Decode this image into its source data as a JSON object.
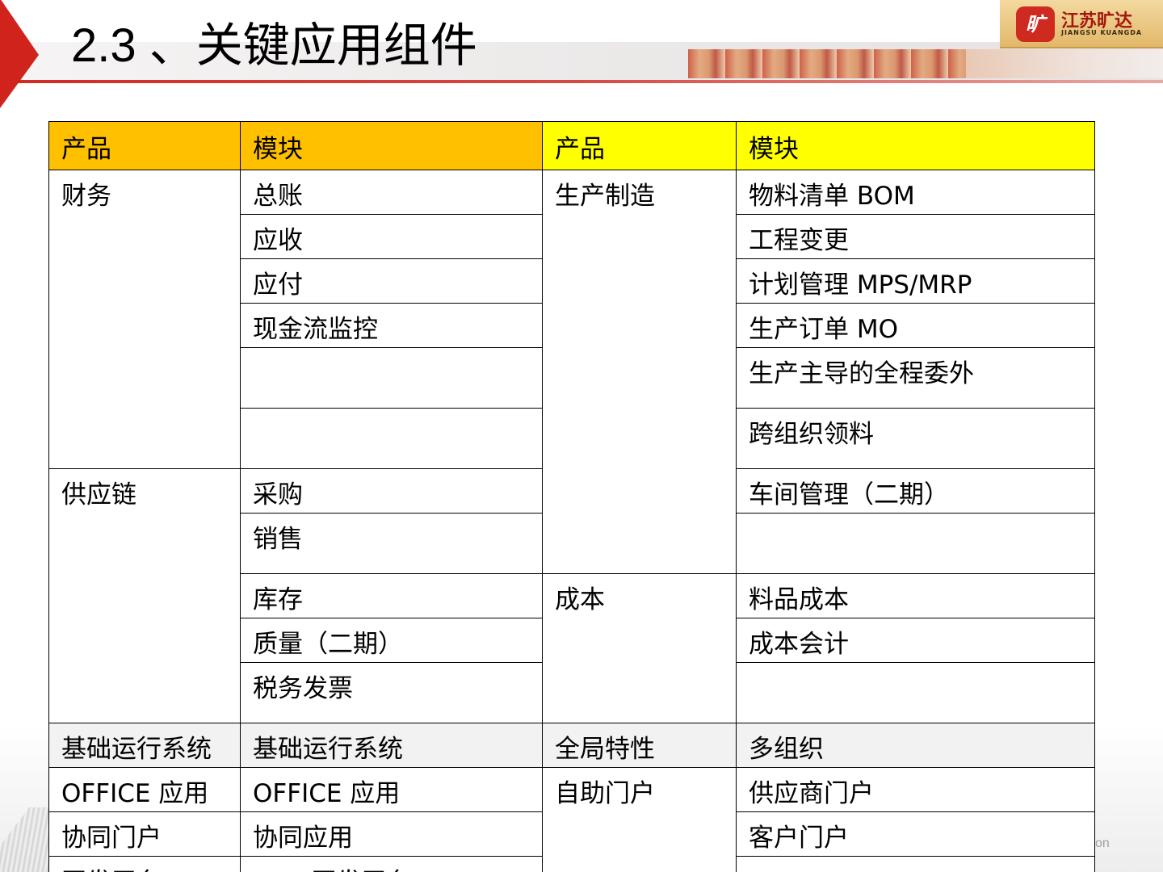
{
  "slide": {
    "title": "2.3 、关键应用组件",
    "corner_text": "on"
  },
  "logo": {
    "mark": "旷",
    "name_cn": "江苏旷达",
    "name_en": "JIANGSU KUANGDA"
  },
  "colors": {
    "header_left": "#ffc000",
    "header_right": "#ffff00",
    "accent_red": "#d0231c",
    "shaded_row": "#f2f2f2"
  },
  "table": {
    "headers": [
      "产品",
      "模块",
      "产品",
      "模块"
    ],
    "c0": [
      "财务",
      "供应链",
      "基础运行系统",
      "OFFICE 应用",
      "协同门户",
      "开发平台"
    ],
    "c1": [
      "总账",
      "应收",
      "应付",
      "现金流监控",
      "",
      "",
      "采购",
      "销售",
      "库存",
      "质量（二期）",
      "税务发票",
      "基础运行系统",
      "OFFICE 应用",
      "协同应用",
      "UAP 开发平台"
    ],
    "c2": [
      "生产制造",
      "成本",
      "全局特性",
      "自助门户"
    ],
    "c3": [
      "物料清单 BOM",
      "工程变更",
      "计划管理 MPS/MRP",
      "生产订单 MO",
      "生产主导的全程委外",
      "跨组织领料",
      "车间管理（二期）",
      "",
      "料品成本",
      "成本会计",
      "",
      "多组织",
      "供应商门户",
      "客户门户",
      ""
    ]
  }
}
